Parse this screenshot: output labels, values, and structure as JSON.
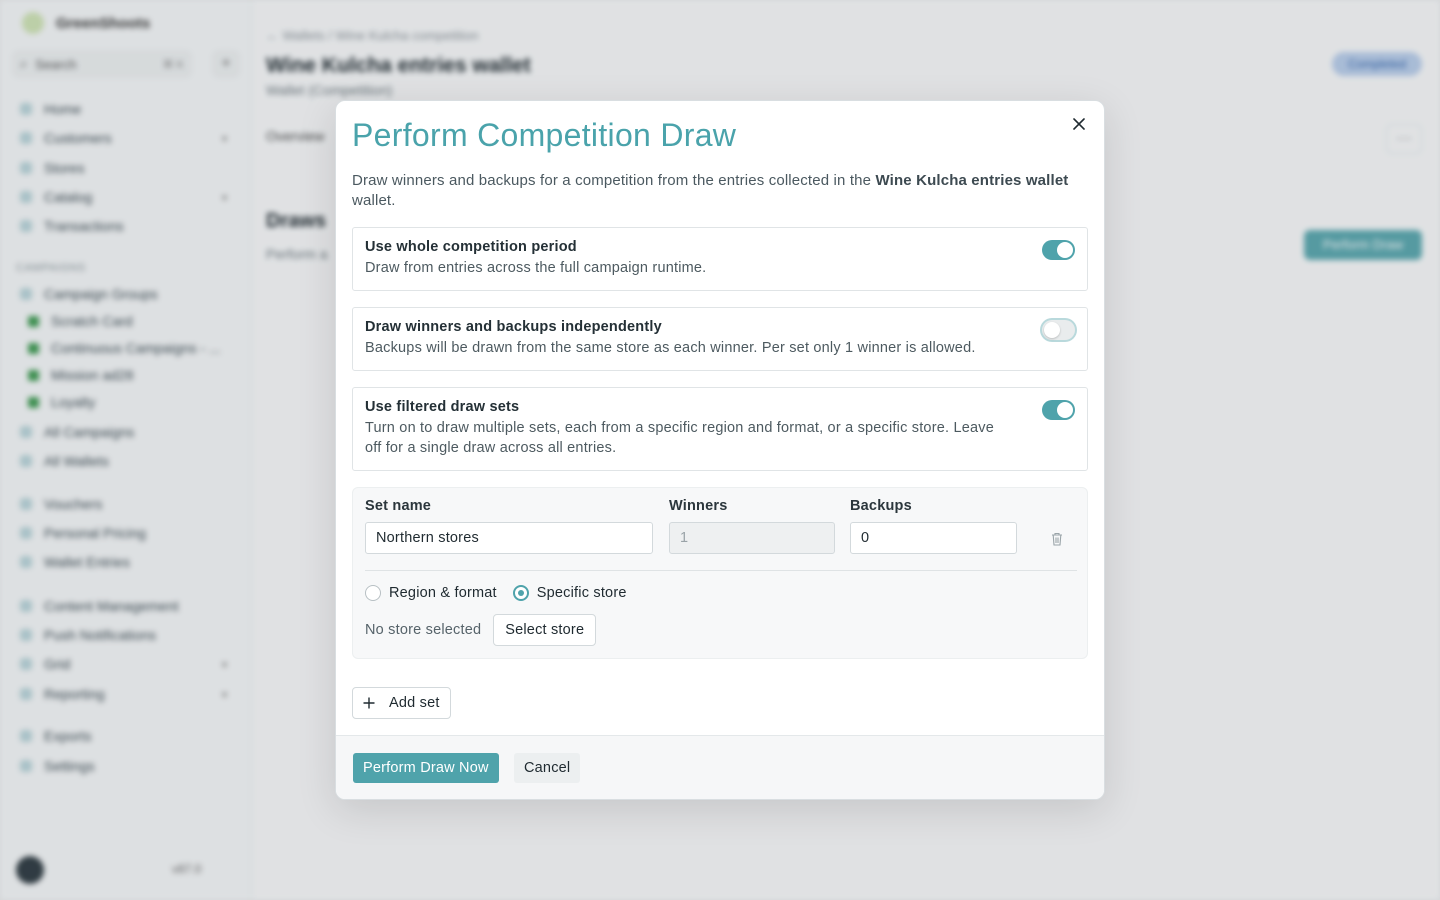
{
  "background": {
    "brand": "GreenShoots",
    "search": {
      "placeholder": "Search",
      "shortcut": "⌘ K"
    },
    "nav_top": [
      "Home",
      "Customers",
      "Stores",
      "Catalog",
      "Transactions"
    ],
    "section_label": "CAMPAIGNS",
    "nav_campaigns": [
      "Campaign Groups",
      "Scratch Card",
      "Continuous Campaigns - ...",
      "Mission ad28",
      "Loyalty",
      "All Campaigns",
      "All Wallets"
    ],
    "nav_mid": [
      "Vouchers",
      "Personal Pricing",
      "Wallet Entries"
    ],
    "nav_bottom": [
      "Content Management",
      "Push Notifications",
      "Grid",
      "Reporting"
    ],
    "nav_last": [
      "Exports",
      "Settings"
    ],
    "version": "v87.0",
    "breadcrumb": "← Wallets / Wine Kulcha competition",
    "page_title": "Wine Kulcha entries wallet",
    "page_subtitle": "Wallet (Competition)",
    "status": "Completed",
    "tab": "Overview",
    "section_title": "Draws",
    "section_sub": "Perform a",
    "perform_btn": "Perform Draw"
  },
  "modal": {
    "title": "Perform Competition Draw",
    "desc_prefix": "Draw winners and backups for a competition from the entries collected in the ",
    "desc_wallet": "Wine Kulcha entries wallet",
    "desc_suffix": " wallet.",
    "options": [
      {
        "title": "Use whole competition period",
        "desc": "Draw from entries across the full campaign runtime.",
        "enabled": true
      },
      {
        "title": "Draw winners and backups independently",
        "desc": "Backups will be drawn from the same store as each winner. Per set only 1 winner is allowed.",
        "enabled": false
      },
      {
        "title": "Use filtered draw sets",
        "desc": "Turn on to draw multiple sets, each from a specific region and format, or a specific store. Leave off for a single draw across all entries.",
        "enabled": true
      }
    ],
    "set": {
      "name_label": "Set name",
      "winners_label": "Winners",
      "backups_label": "Backups",
      "name_value": "Northern stores",
      "winners_value": "1",
      "backups_value": "0",
      "radio_region": "Region & format",
      "radio_store": "Specific store",
      "selected_radio": "store",
      "no_store": "No store selected",
      "select_store": "Select store"
    },
    "add_set": "Add set",
    "perform_now": "Perform Draw Now",
    "cancel": "Cancel"
  },
  "colors": {
    "accent": "#4fa3ab"
  }
}
